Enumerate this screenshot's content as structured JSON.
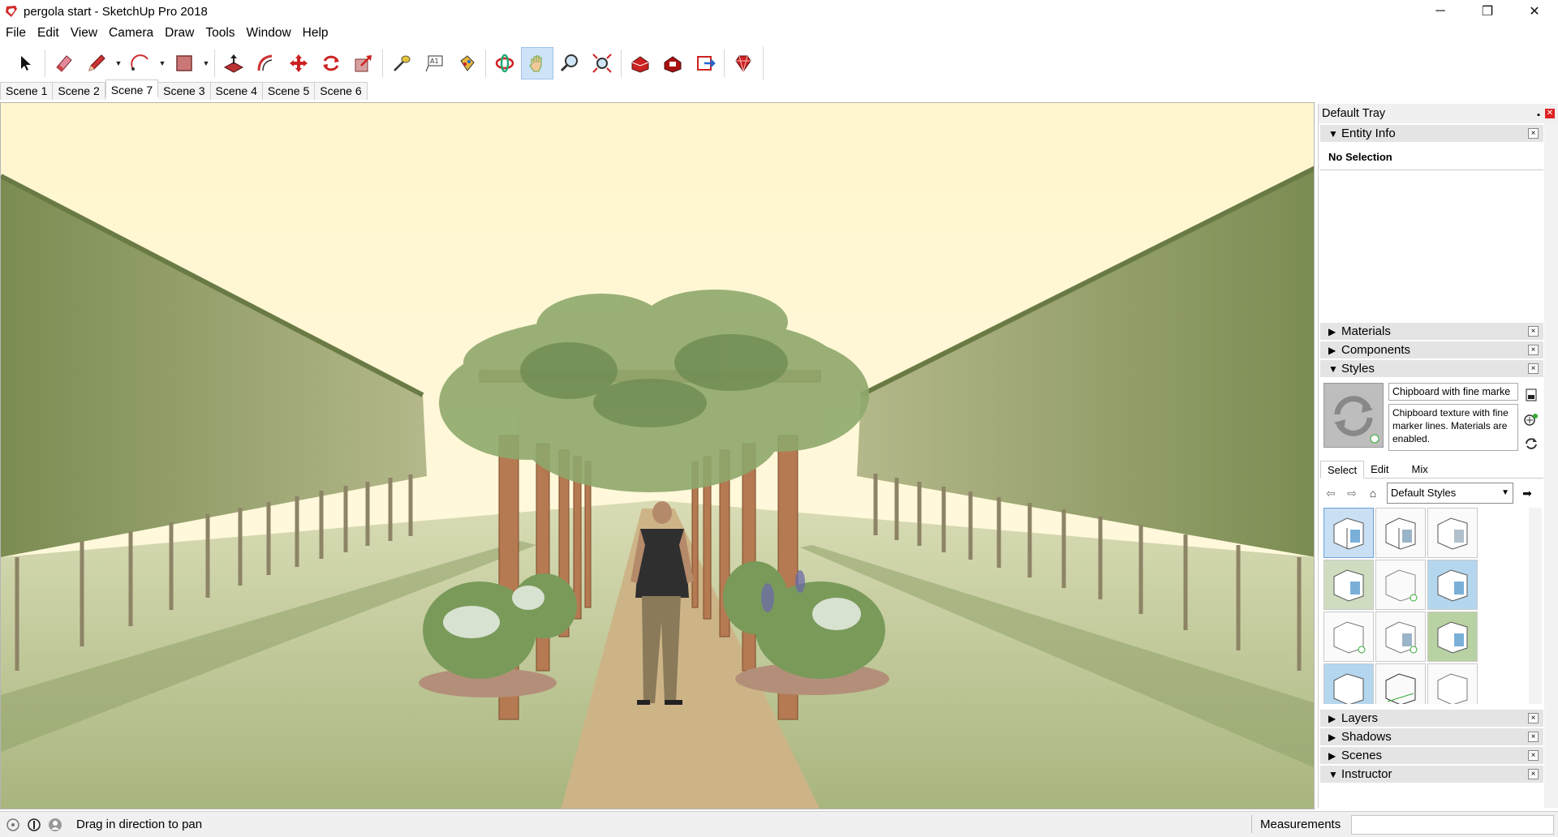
{
  "window": {
    "title": "pergola start - SketchUp Pro 2018",
    "minimize": "─",
    "restore": "❐",
    "close": "✕"
  },
  "menu": [
    "File",
    "Edit",
    "View",
    "Camera",
    "Draw",
    "Tools",
    "Window",
    "Help"
  ],
  "toolbar": {
    "tools": [
      "select-icon",
      "eraser-icon",
      "pencil-icon",
      "arc-icon",
      "rectangle-icon",
      "push-pull-icon",
      "offset-icon",
      "move-icon",
      "rotate-icon",
      "scale-icon",
      "tape-measure-icon",
      "text-icon",
      "paint-bucket-icon",
      "orbit-icon",
      "pan-icon",
      "zoom-icon",
      "zoom-extents-icon",
      "warehouse-icon",
      "extension-warehouse-icon",
      "send-to-layout-icon",
      "ruby-console-icon"
    ],
    "active_tool": "pan-icon"
  },
  "scenes": {
    "tabs": [
      "Scene 1",
      "Scene 2",
      "Scene 7",
      "Scene 3",
      "Scene 4",
      "Scene 5",
      "Scene 6"
    ],
    "active": "Scene 7"
  },
  "tray": {
    "title": "Default Tray",
    "entity_info": {
      "label": "Entity Info",
      "selection": "No Selection"
    },
    "materials": "Materials",
    "components": "Components",
    "styles": {
      "label": "Styles",
      "name": "Chipboard with fine marke",
      "description": "Chipboard texture with fine marker lines. Materials are enabled.",
      "tabs": [
        "Select",
        "Edit",
        "Mix"
      ],
      "active_tab": "Select",
      "library": "Default Styles"
    },
    "layers": "Layers",
    "shadows": "Shadows",
    "scenes": "Scenes",
    "instructor": "Instructor"
  },
  "status": {
    "message": "Drag in direction to pan",
    "measurements_label": "Measurements",
    "measurements_value": ""
  },
  "colors": {
    "sky": "#fff8d6",
    "grass": "#a9b983",
    "path": "#c9b183",
    "hedge": "#7f8f5a",
    "pergola_wood": "#b87a52"
  }
}
